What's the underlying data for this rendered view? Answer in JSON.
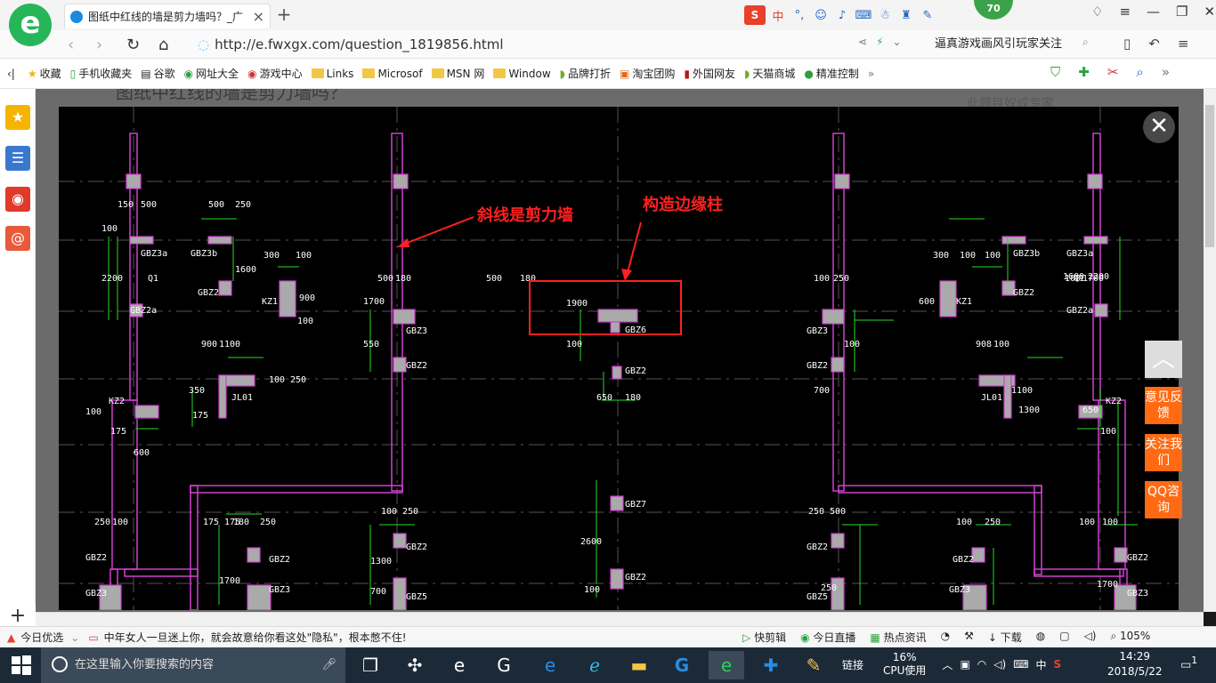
{
  "browser": {
    "tab_title": "图纸中红线的墙是剪力墙吗？_广",
    "url": "http://e.fwxgx.com/question_1819856.html",
    "search_text": "逼真游戏画风引玩家关注",
    "score": "70"
  },
  "bookmarks": [
    "收藏",
    "手机收藏夹",
    "谷歌",
    "网址大全",
    "游戏中心",
    "Links",
    "Microsof",
    "MSN 网",
    "Window",
    "品牌打折",
    "淘宝团购",
    "外国网友",
    "天猫商城",
    "精准控制"
  ],
  "page": {
    "title_fragment": "图纸中红线的墙是剪力墙吗？",
    "side_right": "此题目奴成专家"
  },
  "cad": {
    "annotation_wall": "斜线是剪力墙",
    "annotation_column": "构造边缘柱",
    "labels": [
      "GBZ3a",
      "Q1",
      "GBZ2a",
      "GBZ3b",
      "GBZ2",
      "KZ1",
      "GBZ3",
      "GBZ2",
      "GBZ6",
      "GBZ2",
      "JL01",
      "KZ2",
      "GBZ2",
      "GBZ2",
      "GBZ3",
      "GBZ3",
      "GBZ5",
      "GBZ2",
      "GBZ7",
      "GBZ2",
      "GBZ3a",
      "Q1",
      "GBZ2a",
      "GBZ3b",
      "GBZ2",
      "KZ1",
      "GBZ3",
      "GBZ2",
      "JL01",
      "KZ2",
      "GBZ2",
      "GBZ3",
      "GBZ5",
      "GBZ2",
      "GBZ2",
      "GBZ3"
    ],
    "dims": [
      "150",
      "500",
      "500",
      "250",
      "100",
      "2200",
      "1600",
      "300",
      "100",
      "900",
      "100",
      "500",
      "180",
      "1700",
      "550",
      "500",
      "180",
      "1900",
      "100",
      "900",
      "1100",
      "350",
      "100",
      "100",
      "250",
      "175",
      "175",
      "600",
      "650",
      "180",
      "175",
      "175",
      "250",
      "100",
      "180",
      "250",
      "100",
      "250",
      "2600",
      "1700",
      "1300",
      "700",
      "100",
      "250",
      "500",
      "100",
      "250",
      "100",
      "1700",
      "100",
      "908",
      "100",
      "1300",
      "700",
      "250",
      "100",
      "250",
      "100",
      "100",
      "1700",
      "1100",
      "1600",
      "2200",
      "100",
      "300",
      "100",
      "600",
      "650",
      "100"
    ]
  },
  "float": {
    "close": "✕",
    "feedback": "意见反馈",
    "follow": "关注我们",
    "qq": "QQ咨询"
  },
  "status": {
    "today": "今日优选",
    "news": "中年女人一旦迷上你，就会故意给你看这处\"隐私\"，根本憋不住!",
    "kuaijian": "快剪辑",
    "live": "今日直播",
    "hot": "热点资讯",
    "download": "下载",
    "zoom": "105%"
  },
  "taskbar": {
    "search_placeholder": "在这里输入你要搜索的内容",
    "link": "链接",
    "cpu": "16%",
    "cpu_label": "CPU使用",
    "ime": "中",
    "time": "14:29",
    "date": "2018/5/22",
    "notify": "1"
  }
}
